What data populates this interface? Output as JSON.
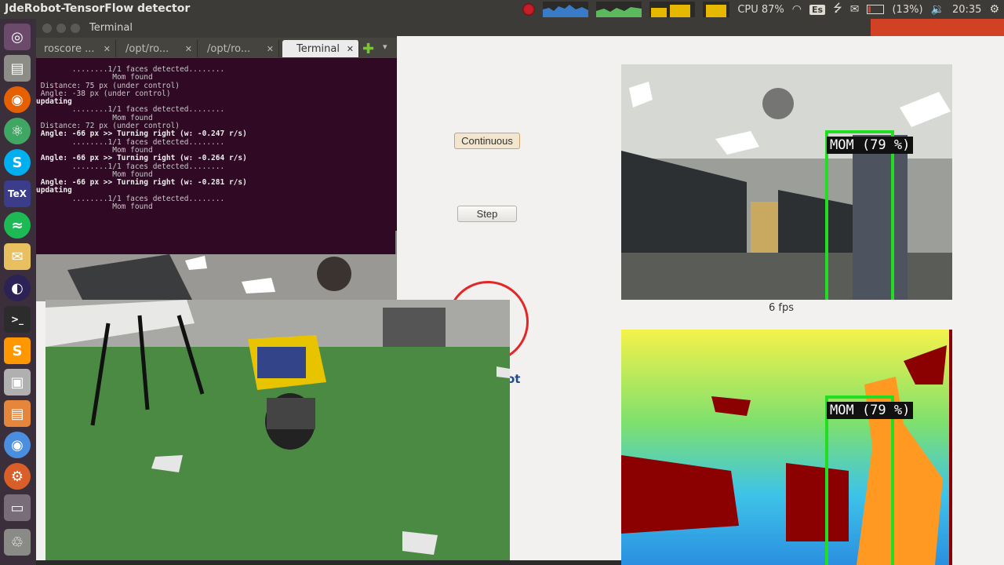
{
  "panel": {
    "app_title": "JdeRobot-TensorFlow detector",
    "cpu": "CPU 87%",
    "keyboard": "Es",
    "battery": "(13%)",
    "time": "20:35"
  },
  "launcher": {
    "icons": [
      "ubuntu-dash-icon",
      "files-icon",
      "firefox-icon",
      "atom-icon",
      "skype-icon",
      "texmaker-icon",
      "spotify-icon",
      "mail-icon",
      "eclipse-icon",
      "terminal-icon",
      "sublime-icon",
      "screenshot-icon",
      "document-viewer-icon",
      "chromium-icon",
      "settings-icon",
      "drive-icon",
      "trash-icon"
    ]
  },
  "terminal": {
    "title": "Terminal",
    "tabs": [
      "roscore ...",
      "/opt/ro...",
      "/opt/ro...",
      "Terminal"
    ],
    "lines": [
      {
        "t": "        ........1/1 faces detected........",
        "b": false
      },
      {
        "t": "                 Mom found",
        "b": false
      },
      {
        "t": " Distance: 75 px (under control)",
        "b": false
      },
      {
        "t": " Angle: -38 px (under control)",
        "b": false
      },
      {
        "t": "updating",
        "b": true
      },
      {
        "t": "",
        "b": false
      },
      {
        "t": "        ........1/1 faces detected........",
        "b": false
      },
      {
        "t": "                 Mom found",
        "b": false
      },
      {
        "t": " Distance: 72 px (under control)",
        "b": false
      },
      {
        "t": " Angle: -66 px >> Turning right (w: -0.247 r/s)",
        "b": true
      },
      {
        "t": "",
        "b": false
      },
      {
        "t": "        ........1/1 faces detected........",
        "b": false
      },
      {
        "t": "                 Mom found",
        "b": false
      },
      {
        "t": " Angle: -66 px >> Turning right (w: -0.264 r/s)",
        "b": true
      },
      {
        "t": "",
        "b": false
      },
      {
        "t": "        ........1/1 faces detected........",
        "b": false
      },
      {
        "t": "                 Mom found",
        "b": false
      },
      {
        "t": " Angle: -66 px >> Turning right (w: -0.281 r/s)",
        "b": true
      },
      {
        "t": "updating",
        "b": true
      },
      {
        "t": "",
        "b": false
      },
      {
        "t": "        ........1/1 faces detected........",
        "b": false
      },
      {
        "t": "                 Mom found",
        "b": false
      }
    ]
  },
  "controls": {
    "continuous_label": "Continuous",
    "step_label": "Step"
  },
  "logo": {
    "text": "ot"
  },
  "rgb": {
    "detection": "MOM (79 %)",
    "fps": "6 fps"
  },
  "depth": {
    "detection": "MOM (79 %)"
  }
}
